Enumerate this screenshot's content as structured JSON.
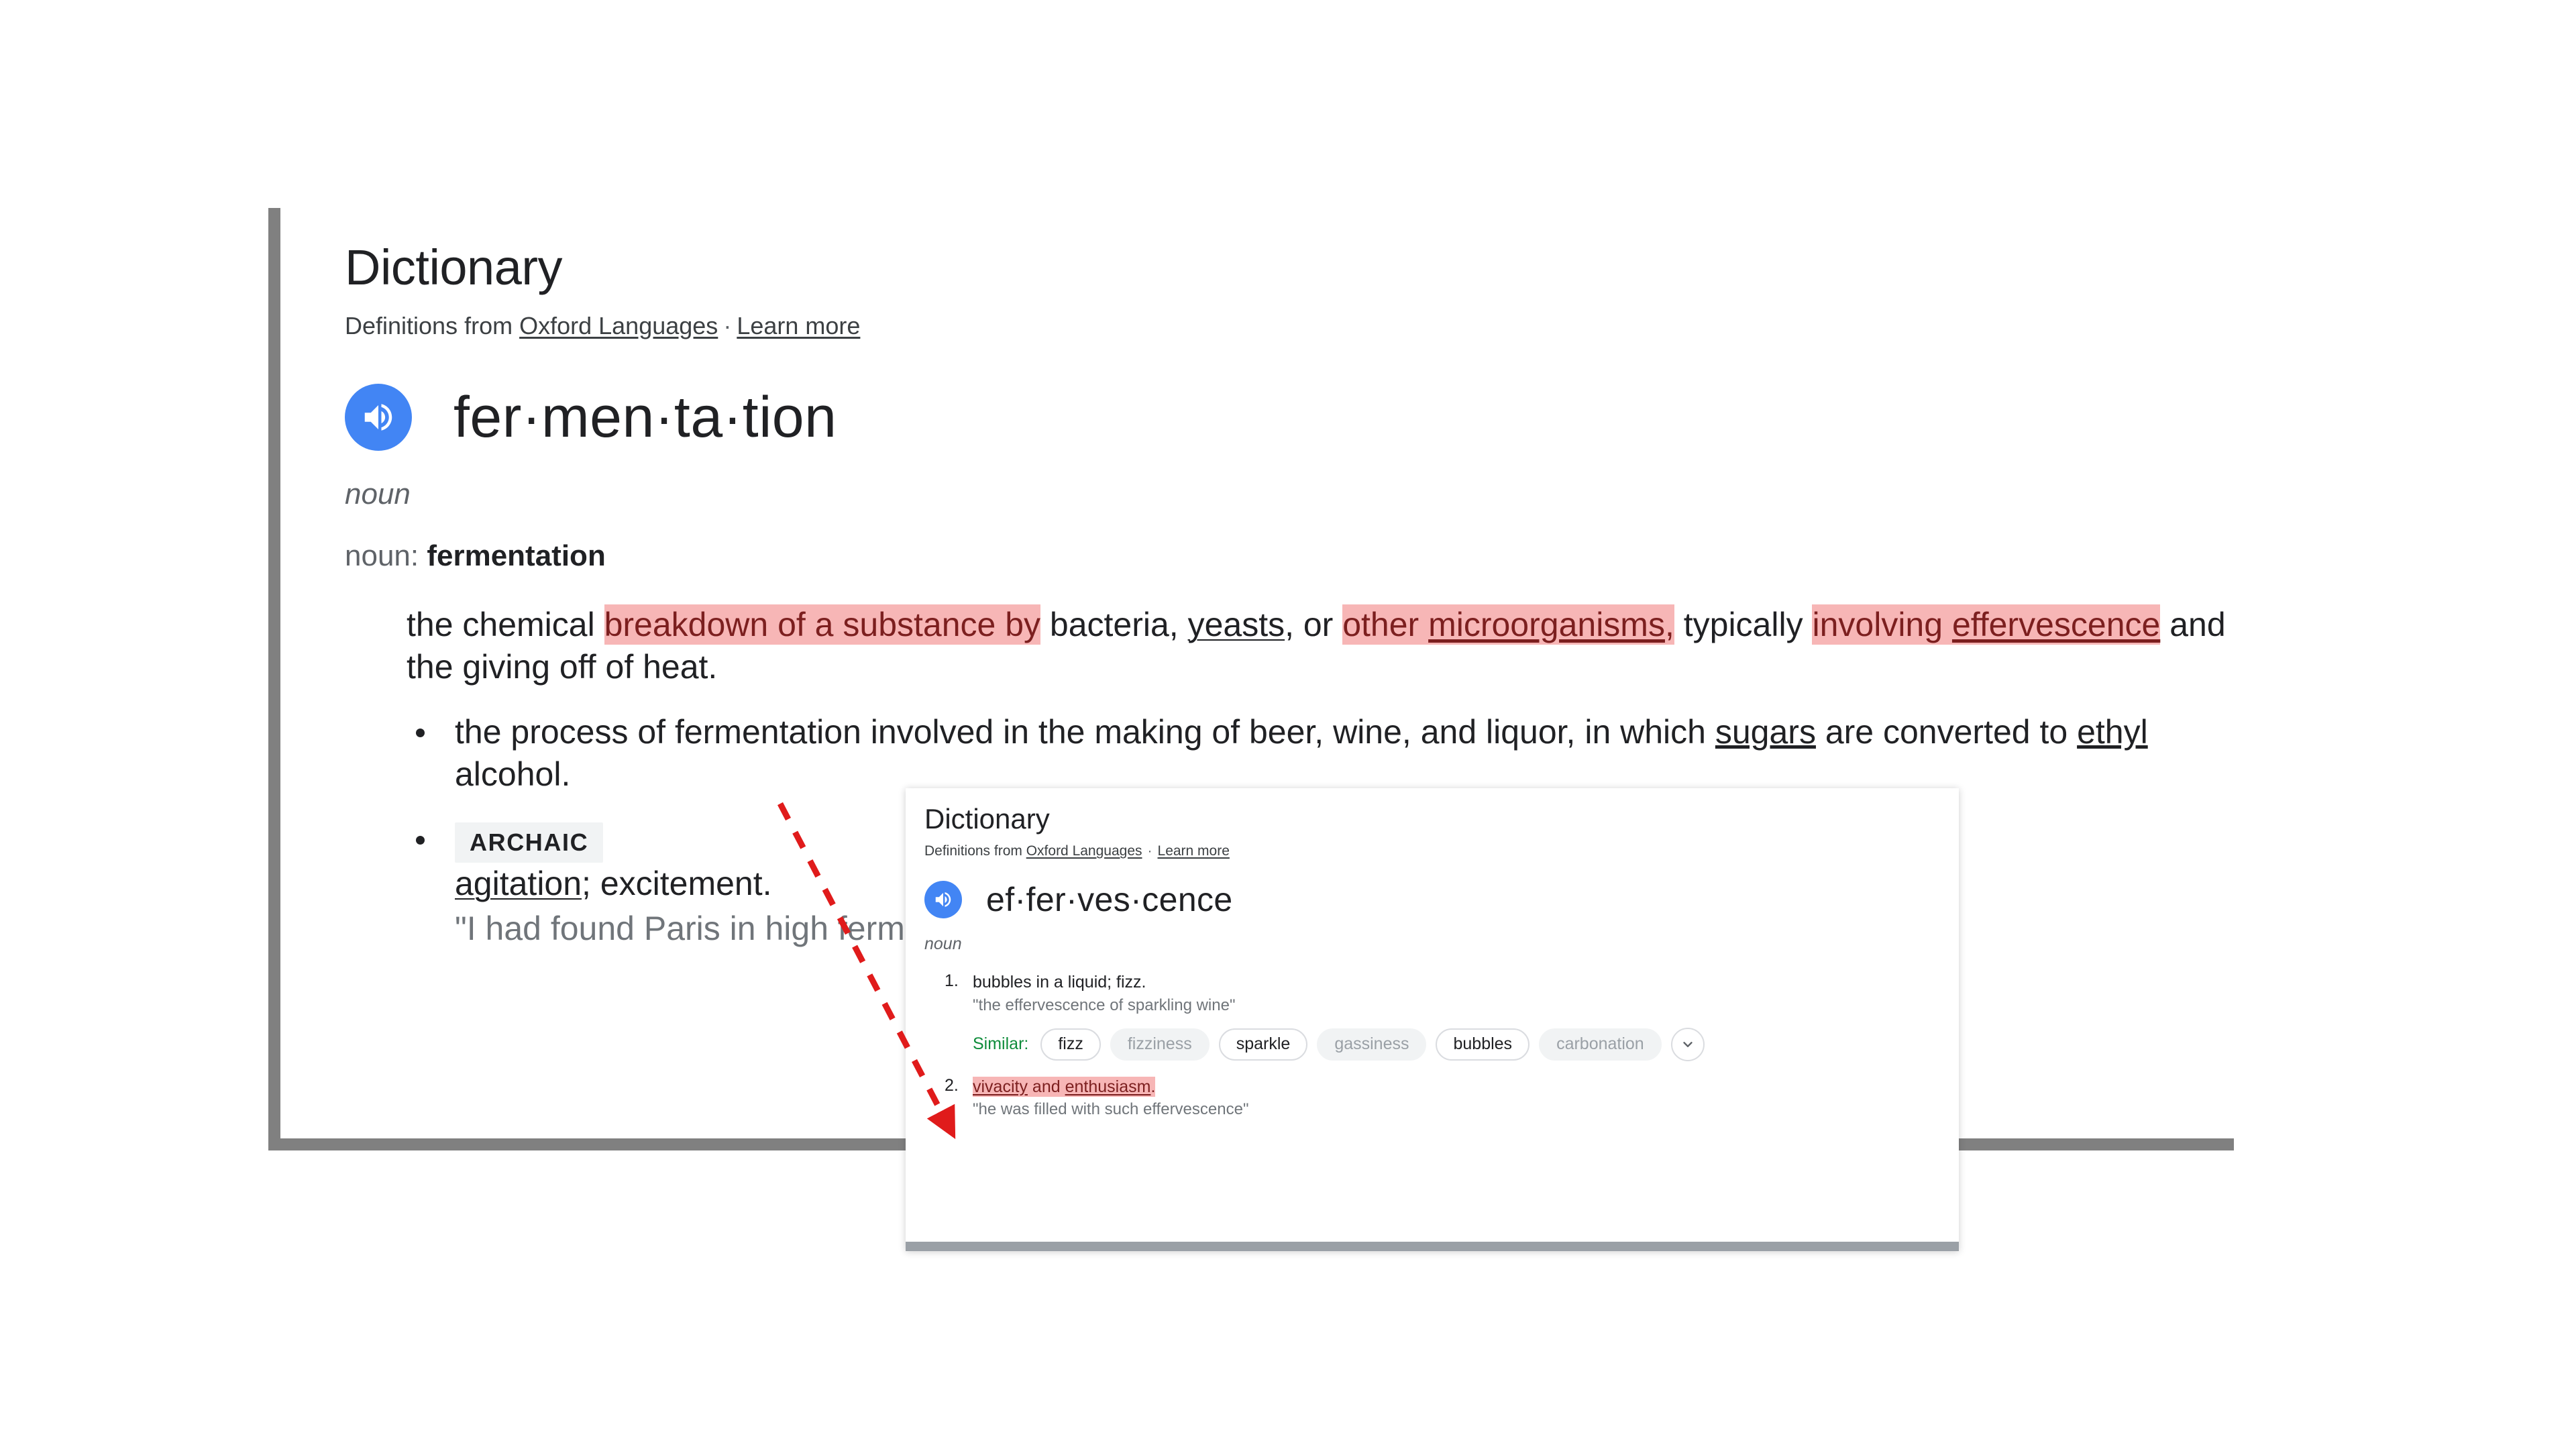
{
  "main_card": {
    "title": "Dictionary",
    "attribution_prefix": "Definitions from ",
    "attribution_source": "Oxford Languages",
    "attribution_sep": "·",
    "attribution_learn_more": "Learn more",
    "speaker_icon": "speaker-icon",
    "headword": "fer·men·ta·tion",
    "part_of_speech": "noun",
    "noun_label": "noun",
    "noun_word": "fermentation",
    "definition_1": {
      "seg_plain_1": "the chemical ",
      "seg_hl_1": "breakdown of a substance by",
      "seg_plain_2": " bacteria, ",
      "seg_link_1": "yeasts",
      "seg_plain_3": ", or ",
      "seg_hl_2a": "other ",
      "seg_hl_2b": "microorganisms",
      "seg_hl_2c": ",",
      "seg_plain_4": " typically ",
      "seg_hl_3a": "involving ",
      "seg_hl_3b": "effervescence",
      "seg_plain_5": " and the giving off of heat."
    },
    "bullets": [
      {
        "text_1": "the process of fermentation",
        "text_occluded": " involved in the making of beer, wine, and liquor, in ",
        "text_2": "which ",
        "link_1": "sugars",
        "text_3": " are converted to ",
        "link_2": "ethyl",
        "text_4": " alcohol."
      },
      {
        "tag": "ARCHAIC",
        "link_1": "agitation",
        "text_1": "; excitement.",
        "example": "\"I had found Paris in high fermentation\""
      }
    ]
  },
  "popup_card": {
    "title": "Dictionary",
    "attribution_prefix": "Definitions from ",
    "attribution_source": "Oxford Languages",
    "attribution_sep": "·",
    "attribution_learn_more": "Learn more",
    "speaker_icon": "speaker-icon",
    "headword": "ef·fer·ves·cence",
    "part_of_speech": "noun",
    "definitions": [
      {
        "number": "1.",
        "text": "bubbles in a liquid; fizz.",
        "example": "\"the effervescence of sparkling wine\""
      },
      {
        "number": "2.",
        "link_1": "vivacity",
        "mid": " and ",
        "link_2": "enthusiasm",
        "end": ".",
        "example": "\"he was filled with such effervescence\""
      }
    ],
    "similar_label": "Similar:",
    "similar_chips": [
      {
        "label": "fizz",
        "style": "outline"
      },
      {
        "label": "fizziness",
        "style": "filled"
      },
      {
        "label": "sparkle",
        "style": "outline"
      },
      {
        "label": "gassiness",
        "style": "filled"
      },
      {
        "label": "bubbles",
        "style": "outline"
      },
      {
        "label": "carbonation",
        "style": "filled"
      }
    ],
    "expand_icon": "chevron-down-icon"
  },
  "annotation": {
    "arrow_icon": "red-dashed-arrow",
    "color": "#e01b1b"
  },
  "colors": {
    "accent_blue": "#4285f4",
    "highlight_pink": "#f7b6b6",
    "highlight_text": "#7c1f1f",
    "similar_green": "#0f8c3b",
    "card_border_gray": "#808080",
    "popup_border_gray": "#9aa0a6"
  }
}
